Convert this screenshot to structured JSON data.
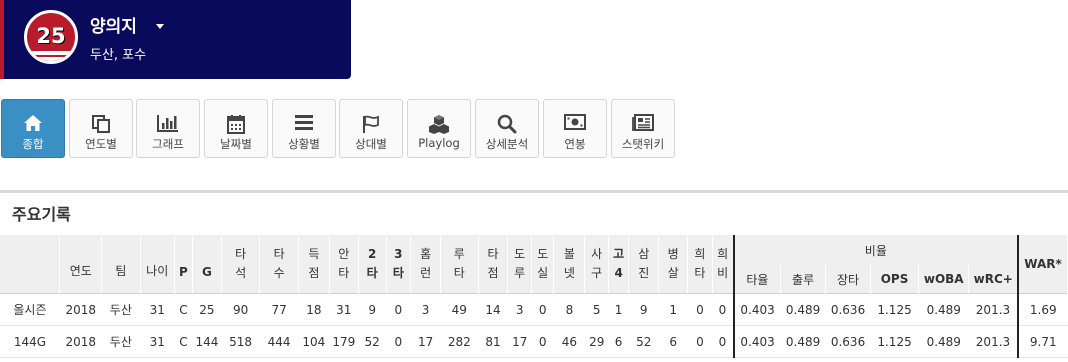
{
  "player": {
    "number": "25",
    "name": "양의지",
    "team_position": "두산, 포수"
  },
  "nav": [
    {
      "label": "종합",
      "icon": "home-icon",
      "active": true
    },
    {
      "label": "연도별",
      "icon": "copy-icon",
      "active": false
    },
    {
      "label": "그래프",
      "icon": "bar-chart-icon",
      "active": false
    },
    {
      "label": "날짜별",
      "icon": "calendar-icon",
      "active": false
    },
    {
      "label": "상황별",
      "icon": "list-icon",
      "active": false
    },
    {
      "label": "상대별",
      "icon": "flag-icon",
      "active": false
    },
    {
      "label": "Playlog",
      "icon": "cubes-icon",
      "active": false
    },
    {
      "label": "상세분석",
      "icon": "search-icon",
      "active": false
    },
    {
      "label": "연봉",
      "icon": "money-icon",
      "active": false
    },
    {
      "label": "스탯위키",
      "icon": "newspaper-icon",
      "active": false
    }
  ],
  "section": {
    "title": "주요기록"
  },
  "table": {
    "headers": [
      "연도",
      "팀",
      "나이",
      "P",
      "G",
      "타\n석",
      "타\n수",
      "득\n점",
      "안\n타",
      "2\n타",
      "3\n타",
      "홈\n런",
      "루\n타",
      "타\n점",
      "도\n루",
      "도\n실",
      "볼\n넷",
      "사\n구",
      "고\n4",
      "삼\n진",
      "병\n살",
      "희\n타",
      "희\n비"
    ],
    "ratio_group": "비율",
    "ratio_headers": [
      "타율",
      "출루",
      "장타",
      "OPS",
      "wOBA",
      "wRC+"
    ],
    "war_header": "WAR*",
    "rows": [
      [
        "올시즌",
        "2018",
        "두산",
        "31",
        "C",
        "25",
        "90",
        "77",
        "18",
        "31",
        "9",
        "0",
        "3",
        "49",
        "14",
        "3",
        "0",
        "8",
        "5",
        "1",
        "9",
        "1",
        "0",
        "0",
        "0.403",
        "0.489",
        "0.636",
        "1.125",
        "0.489",
        "201.3",
        "1.69"
      ],
      [
        "144G",
        "2018",
        "두산",
        "31",
        "C",
        "144",
        "518",
        "444",
        "104",
        "179",
        "52",
        "0",
        "17",
        "282",
        "81",
        "17",
        "0",
        "46",
        "29",
        "6",
        "52",
        "6",
        "0",
        "0",
        "0.403",
        "0.489",
        "0.636",
        "1.125",
        "0.489",
        "201.3",
        "9.71"
      ]
    ]
  },
  "colors": {
    "card_bg": "#0a0a5c",
    "card_accent": "#b81c2c",
    "active_tab": "#3a8fc4"
  }
}
